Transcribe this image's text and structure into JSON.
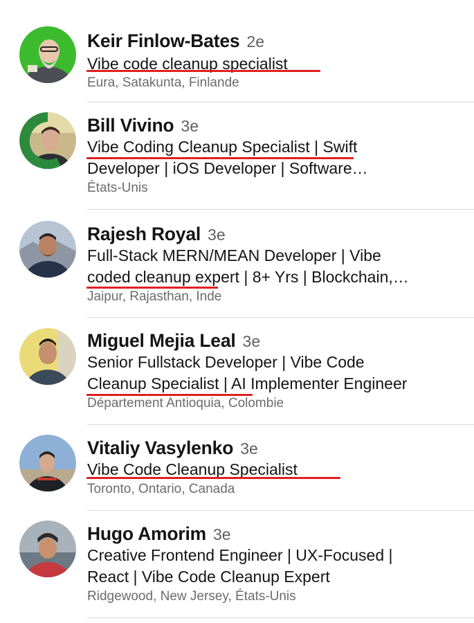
{
  "people": [
    {
      "name": "Keir Finlow-Bates",
      "degree": "2e",
      "headline": [
        "Vibe code cleanup specialist"
      ],
      "location": "Eura, Satakunta, Finlande",
      "avatar_bg": "#3dbb2e"
    },
    {
      "name": "Bill Vivino",
      "degree": "3e",
      "headline": [
        "Vibe Coding Cleanup Specialist | Swift",
        "Developer | iOS Developer | Software…"
      ],
      "location": "États-Unis",
      "badge": "#OPENTOWORK",
      "avatar_bg": "#c9b98a"
    },
    {
      "name": "Rajesh Royal",
      "degree": "3e",
      "headline": [
        "Full-Stack MERN/MEAN Developer | Vibe",
        "coded cleanup expert | 8+ Yrs | Blockchain,…"
      ],
      "location": "Jaipur, Rajasthan, Inde",
      "avatar_bg": "#aab4c2"
    },
    {
      "name": "Miguel Mejia Leal",
      "degree": "3e",
      "headline": [
        "Senior Fullstack Developer | Vibe Code",
        "Cleanup Specialist | AI Implementer Engineer"
      ],
      "location": "Département Antioquia, Colombie",
      "avatar_bg": "#e9dc78"
    },
    {
      "name": "Vitaliy Vasylenko",
      "degree": "3e",
      "headline": [
        "Vibe Code Cleanup Specialist"
      ],
      "location": "Toronto, Ontario, Canada",
      "avatar_bg": "#6f8db5"
    },
    {
      "name": "Hugo Amorim",
      "degree": "3e",
      "headline": [
        "Creative Frontend Engineer | UX-Focused |",
        "React | Vibe Code Cleanup Expert"
      ],
      "location": "Ridgewood, New Jersey, États-Unis",
      "avatar_bg": "#9aa6b0"
    }
  ],
  "highlight_color": "#e02020"
}
